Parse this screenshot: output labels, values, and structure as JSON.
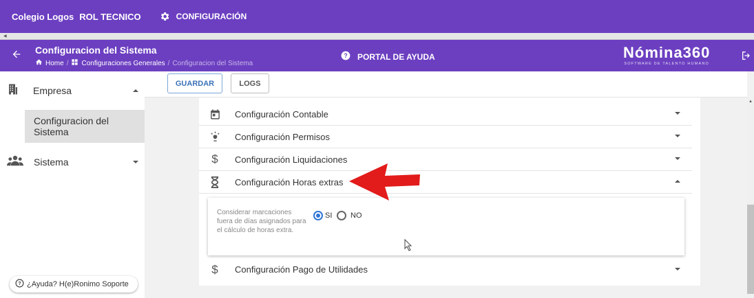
{
  "topbar": {
    "school": "Colegio Logos",
    "role": "ROL TECNICO",
    "config_label": "CONFIGURACIÓN",
    "gear_icon": "gear-icon"
  },
  "appbar": {
    "title": "Configuracion del Sistema",
    "breadcrumb": {
      "home": "Home",
      "section": "Configuraciones Generales",
      "current": "Configuracion del Sistema"
    },
    "help_label": "PORTAL DE AYUDA",
    "brand_name": "Nómina360",
    "brand_tagline": "SOFTWARE DE TALENTO HUMANO"
  },
  "sidebar": {
    "items": [
      {
        "label": "Empresa",
        "icon": "building-icon",
        "expanded": true
      },
      {
        "label": "Configuracion del Sistema",
        "selected": true
      },
      {
        "label": "Sistema",
        "icon": "people-icon",
        "expanded": false
      }
    ],
    "help_button": "¿Ayuda? H(e)Ronimo Soporte"
  },
  "toolbar": {
    "save_label": "GUARDAR",
    "logs_label": "LOGS"
  },
  "sections": [
    {
      "label": "Configuración Contable",
      "icon": "calendar-icon",
      "expanded": false
    },
    {
      "label": "Configuración Permisos",
      "icon": "lightbulb-icon",
      "expanded": false
    },
    {
      "label": "Configuración Liquidaciones",
      "icon": "dollar-icon",
      "expanded": false
    },
    {
      "label": "Configuración Horas extras",
      "icon": "hourglass-icon",
      "expanded": true
    },
    {
      "label": "Configuración Pago de Utilidades",
      "icon": "dollar-icon",
      "expanded": false
    }
  ],
  "horas_extras": {
    "description": "Considerar marcaciones fuera de días asignados para el cálculo de horas extra.",
    "options": [
      {
        "label": "SI",
        "selected": true
      },
      {
        "label": "NO",
        "selected": false
      }
    ]
  },
  "colors": {
    "purple": "#6c3fc1",
    "accent_blue": "#2f76d6",
    "annotation_red": "#e21b1b"
  }
}
